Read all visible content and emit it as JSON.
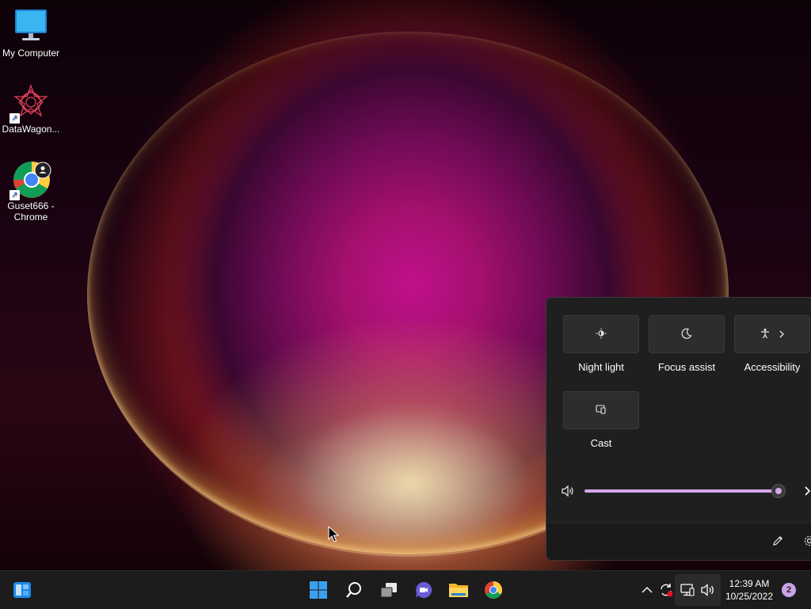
{
  "desktop": {
    "icons": [
      {
        "label": "My Computer",
        "icon": "monitor-icon"
      },
      {
        "label": "DataWagon...",
        "icon": "datawagon-icon"
      },
      {
        "label": "Guset666 - Chrome",
        "icon": "chrome-icon"
      }
    ]
  },
  "quick_settings": {
    "tiles": [
      {
        "label": "Night light",
        "icon": "night-light-icon"
      },
      {
        "label": "Focus assist",
        "icon": "moon-icon"
      },
      {
        "label": "Accessibility",
        "icon": "accessibility-icon"
      },
      {
        "label": "Cast",
        "icon": "cast-icon"
      }
    ],
    "volume": {
      "level": 0.98,
      "icon": "speaker-icon"
    },
    "footer": {
      "edit_icon": "pencil-icon",
      "settings_icon": "gear-icon"
    }
  },
  "taskbar": {
    "apps": [
      "widgets-icon",
      "start-icon",
      "search-icon",
      "task-view-icon",
      "chat-icon",
      "file-explorer-icon",
      "chrome-icon"
    ],
    "tray": {
      "time": "12:39 AM",
      "date": "10/25/2022",
      "notification_count": "2"
    }
  },
  "colors": {
    "accent": "#d4a8e8",
    "panel_bg": "#1f1f1f",
    "taskbar_bg": "#1c1c1c"
  }
}
